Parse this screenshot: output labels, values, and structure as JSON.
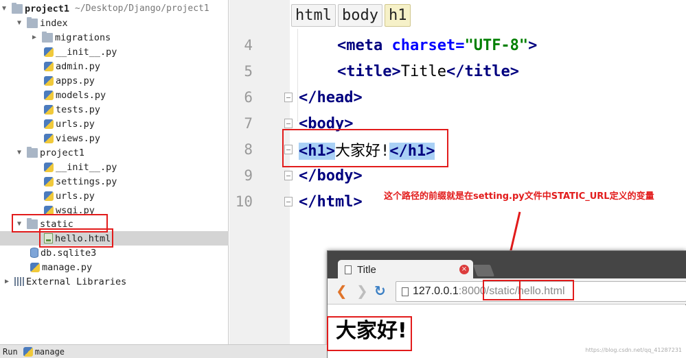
{
  "tree": {
    "project": {
      "name": "project1",
      "path": "~/Desktop/Django/project1"
    },
    "index_folder": "index",
    "index_items": [
      "migrations",
      "__init__.py",
      "admin.py",
      "apps.py",
      "models.py",
      "tests.py",
      "urls.py",
      "views.py"
    ],
    "project_folder": "project1",
    "project_items": [
      "__init__.py",
      "settings.py",
      "urls.py",
      "wsgi.py"
    ],
    "static_folder": "static",
    "static_items": [
      "hello.html"
    ],
    "root_items": [
      "db.sqlite3",
      "manage.py"
    ],
    "external": "External Libraries"
  },
  "breadcrumbs": [
    "html",
    "body",
    "h1"
  ],
  "editor": {
    "lines": [
      {
        "num": "4",
        "parts": [
          {
            "t": "<",
            "c": "tag"
          },
          {
            "t": "meta",
            "c": "tag"
          },
          {
            "t": " ",
            "c": ""
          },
          {
            "t": "charset",
            "c": "attr"
          },
          {
            "t": "=",
            "c": "attr"
          },
          {
            "t": "\"UTF-8\"",
            "c": "str"
          },
          {
            "t": ">",
            "c": "tag"
          }
        ]
      },
      {
        "num": "5",
        "parts": [
          {
            "t": "<",
            "c": "tag"
          },
          {
            "t": "title",
            "c": "tag"
          },
          {
            "t": ">",
            "c": "tag"
          },
          {
            "t": "Title",
            "c": ""
          },
          {
            "t": "</",
            "c": "tag"
          },
          {
            "t": "title",
            "c": "tag"
          },
          {
            "t": ">",
            "c": "tag"
          }
        ]
      },
      {
        "num": "6",
        "parts": [
          {
            "t": "</",
            "c": "tag"
          },
          {
            "t": "head",
            "c": "tag"
          },
          {
            "t": ">",
            "c": "tag"
          }
        ]
      },
      {
        "num": "7",
        "parts": [
          {
            "t": "<",
            "c": "tag"
          },
          {
            "t": "body",
            "c": "tag"
          },
          {
            "t": ">",
            "c": "tag"
          }
        ]
      },
      {
        "num": "8",
        "parts": [
          {
            "t": "<h1>",
            "c": "tag hl"
          },
          {
            "t": "大家好!",
            "c": ""
          },
          {
            "t": "</h1>",
            "c": "tag hl"
          }
        ]
      },
      {
        "num": "9",
        "parts": [
          {
            "t": "</",
            "c": "tag"
          },
          {
            "t": "body",
            "c": "tag"
          },
          {
            "t": ">",
            "c": "tag"
          }
        ]
      },
      {
        "num": "10",
        "parts": [
          {
            "t": "</",
            "c": "tag"
          },
          {
            "t": "html",
            "c": "tag"
          },
          {
            "t": ">",
            "c": "tag"
          }
        ]
      }
    ]
  },
  "annotation": "这个路径的前缀就是在setting.py文件中STATIC_URL定义的变量",
  "browser": {
    "tab_title": "Title",
    "close_glyph": "×",
    "url_host": "127.0.0.1",
    "url_port": ":8000",
    "url_static": "/static/",
    "url_file": "hello.html",
    "page_heading": "大家好!"
  },
  "status": {
    "run_label": "Run",
    "config": "manage"
  },
  "watermark": "https://blog.csdn.net/qq_41287231",
  "colors": {
    "accent_red": "#e21b1b",
    "tag_blue": "#00007f",
    "string_green": "#007f00",
    "highlight": "#a9d0f5"
  }
}
